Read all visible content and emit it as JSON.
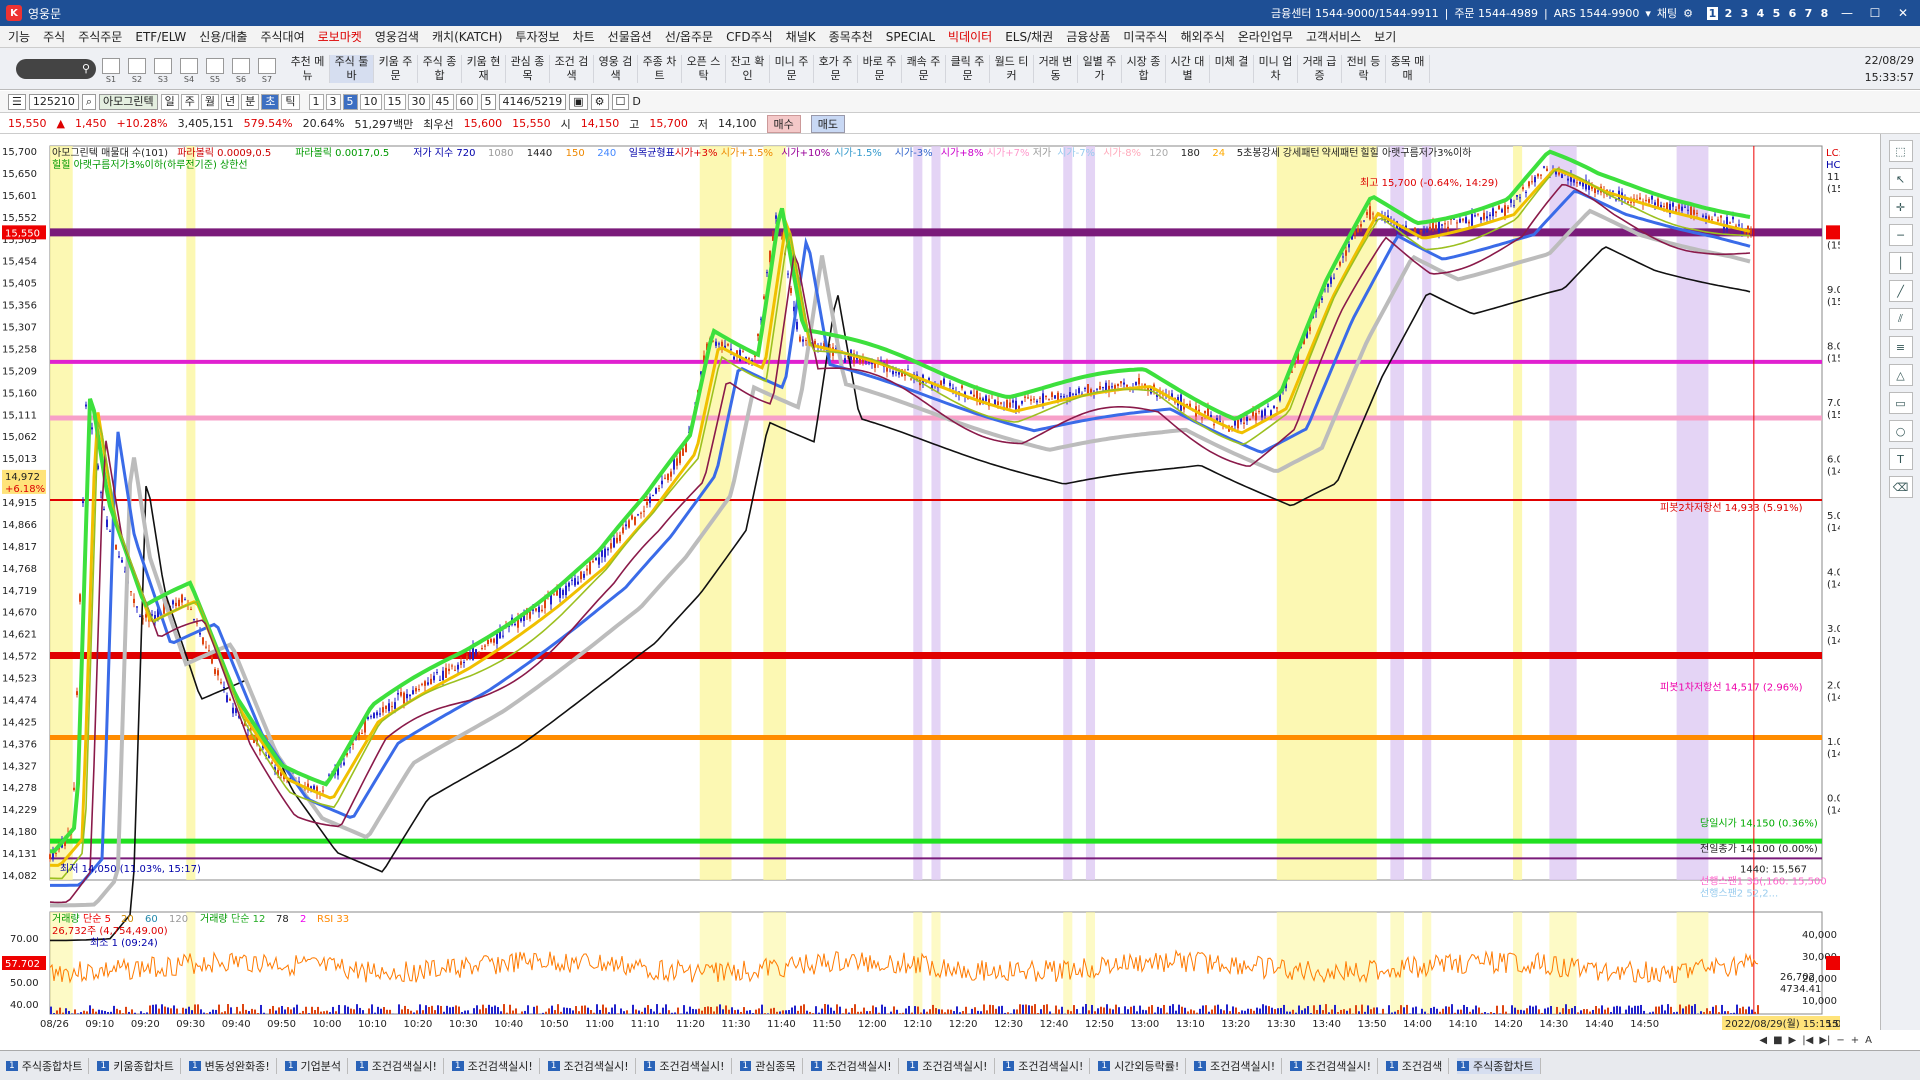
{
  "app": {
    "title": "영웅문",
    "company_center": "금융센터 1544-9000/1544-9911",
    "order_center": "주문 1544-4989",
    "ars": "ARS 1544-9900",
    "chat": "채팅",
    "pages": [
      "1",
      "2",
      "3",
      "4",
      "5",
      "6",
      "7",
      "8"
    ]
  },
  "menu": [
    "기능",
    "주식",
    "주식주문",
    "ETF/ELW",
    "신용/대출",
    "주식대여",
    "로보마켓",
    "영웅검색",
    "캐치(KATCH)",
    "투자정보",
    "차트",
    "선물옵션",
    "선/옵주문",
    "CFD주식",
    "채널K",
    "종목추천",
    "SPECIAL",
    "빅데이터",
    "ELS/채권",
    "금융상품",
    "미국주식",
    "해외주식",
    "온라인업무",
    "고객서비스",
    "보기"
  ],
  "toolbar": {
    "icon_labels": [
      "S1",
      "S2",
      "S3",
      "S4",
      "S5",
      "S6",
      "S7"
    ],
    "buttons": [
      "추천 메뉴",
      "주식 툴바",
      "키움 주문",
      "주식 종합",
      "키움 현재",
      "관심 종목",
      "조건 검색",
      "영웅 검색",
      "주종 차트",
      "오픈 스탁",
      "잔고 확인",
      "미니 주문",
      "호가 주문",
      "바로 주문",
      "쾌속 주문",
      "클릭 주문",
      "월드 티커",
      "거래 변동",
      "일별 주가",
      "시장 종합",
      "시간 대별",
      "미체 결",
      "미니 업차",
      "거래 급증",
      "전비 등락",
      "종목 매매"
    ],
    "date": "22/08/29",
    "time": "15:33:57"
  },
  "controls": {
    "code": "125210",
    "stock_name": "아모그린텍",
    "periods": [
      "일",
      "주",
      "월",
      "년",
      "분",
      "초",
      "틱"
    ],
    "intervals": [
      "1",
      "3",
      "5",
      "10",
      "15",
      "30",
      "45",
      "60"
    ],
    "selected_interval": "5",
    "count": "5",
    "range": "4146/5219",
    "d_label": "D"
  },
  "quote": {
    "price": "15,550",
    "change": "1,450",
    "change_rate": "+10.28%",
    "volume": "3,405,151",
    "vol_ratio": "579.54%",
    "turnover": "20.64%",
    "amount": "51,297백만",
    "best_ask_label": "최우선",
    "ask": "15,600",
    "bid": "15,550",
    "open_label": "시",
    "open": "14,150",
    "high_label": "고",
    "high": "15,700",
    "low_label": "저",
    "low": "14,100",
    "buy": "매수",
    "sell": "매도"
  },
  "legend": {
    "line1": [
      "아모그린텍 매물대 수(101)",
      "파라볼릭 0.0009,0.5",
      "파라볼릭 0.0017,0.5",
      "저가 지수 720",
      "1080",
      "1440",
      "150",
      "240",
      "일목균형표",
      "시가+3%",
      "시가+1.5%",
      "시가+10%",
      "시가-1.5%",
      "시가-3%",
      "시가+8%",
      "시가+7%",
      "저가",
      "시가-7%",
      "시가-8%",
      "120",
      "180",
      "24",
      "5초봉강세",
      "강세패턴",
      "약세패턴",
      "힐힐 아랫구름저가3%이하"
    ],
    "line2": "힐힐 아랫구름저가3%이하(하루전기준) 상한선"
  },
  "annotations": {
    "high": "최고 15,700 (-0.64%, 14:29)",
    "low": "최저 14,050 (11.03%, 15:17)",
    "pivot2": "피봇2차저항선 14,933 (5.91%)",
    "pivot1": "피봇1차저항선 14,517 (2.96%)",
    "open_line": "당일시가 14,150 (0.36%)",
    "prev": "전일종가 14,100 (0.00%)",
    "span1": "1440: 15,567",
    "span2": "선행스팬1 36(,160: 15,500",
    "span3": "선행스팬2 52,2...",
    "lc": "LC:10.68",
    "hc": "HC:-0.96",
    "cur_price": "15,550",
    "cur_rate": "10.28%",
    "cross_price": "14,972",
    "cross_rate": "+6.18%"
  },
  "price_axis": [
    "15,700",
    "15,650",
    "15,601",
    "15,552",
    "15,503",
    "15,454",
    "15,405",
    "15,356",
    "15,307",
    "15,258",
    "15,209",
    "15,160",
    "15,111",
    "15,062",
    "15,013",
    "14,964",
    "14,915",
    "14,866",
    "14,817",
    "14,768",
    "14,719",
    "14,670",
    "14,621",
    "14,572",
    "14,523",
    "14,474",
    "14,425",
    "14,376",
    "14,327",
    "14,278",
    "14,229",
    "14,180",
    "14,131",
    "14,082"
  ],
  "pct_axis": [
    {
      "p": "11.0%",
      "v": "(15,651)"
    },
    {
      "p": "10.0%",
      "v": "(15,510)"
    },
    {
      "p": "9.0%",
      "v": "(15,369)"
    },
    {
      "p": "8.0%",
      "v": "(15,228)"
    },
    {
      "p": "7.0%",
      "v": "(15,087)"
    },
    {
      "p": "6.0%",
      "v": "(14,946)"
    },
    {
      "p": "5.0%",
      "v": "(14,805)"
    },
    {
      "p": "4.0%",
      "v": "(14,664)"
    },
    {
      "p": "3.0%",
      "v": "(14,523)"
    },
    {
      "p": "2.0%",
      "v": "(14,382)"
    },
    {
      "p": "1.0%",
      "v": "(14,241)"
    },
    {
      "p": "0.0%",
      "v": "(14,100)"
    }
  ],
  "sub_legend": [
    "거래량",
    "단순 5",
    "20",
    "60",
    "120",
    "거래량",
    "단순 12",
    "78",
    "2",
    "RSI 33"
  ],
  "sub_notes": [
    "26,732주 (4,754,49.00)",
    "최소 1 (09:24)"
  ],
  "sub_left_axis": [
    "70.00",
    "60.00",
    "50.00",
    "40.00"
  ],
  "sub_right_axis": [
    "40,000",
    "30,000",
    "20,000",
    "10,000"
  ],
  "sub_cur": {
    "rsi": "57.702",
    "vol": "26,702",
    "vol2": "4734.41"
  },
  "time_axis": [
    "08/26",
    "09:10",
    "09:20",
    "09:30",
    "09:40",
    "09:50",
    "10:00",
    "10:10",
    "10:20",
    "10:30",
    "10:40",
    "10:50",
    "11:00",
    "11:10",
    "11:20",
    "11:30",
    "11:40",
    "11:50",
    "12:00",
    "12:10",
    "12:20",
    "12:30",
    "12:40",
    "12:50",
    "13:00",
    "13:10",
    "13:20",
    "13:30",
    "13:40",
    "13:50",
    "14:00",
    "14:10",
    "14:20",
    "14:30",
    "14:40",
    "14:50"
  ],
  "time_cursor": "2022/08/29(월) 15:15:05",
  "time_end": "15:30:00",
  "chart_data": {
    "type": "line",
    "title": "",
    "x_range": [
      "09:00",
      "15:30"
    ],
    "ylim": [
      14050,
      15750
    ],
    "price_path": [
      {
        "t": "09:00",
        "v": 14100
      },
      {
        "t": "09:05",
        "v": 14160
      },
      {
        "t": "09:08",
        "v": 15170
      },
      {
        "t": "09:12",
        "v": 14900
      },
      {
        "t": "09:20",
        "v": 14650
      },
      {
        "t": "09:30",
        "v": 14700
      },
      {
        "t": "09:40",
        "v": 14450
      },
      {
        "t": "09:50",
        "v": 14300
      },
      {
        "t": "10:00",
        "v": 14250
      },
      {
        "t": "10:10",
        "v": 14420
      },
      {
        "t": "10:30",
        "v": 14550
      },
      {
        "t": "10:50",
        "v": 14700
      },
      {
        "t": "11:00",
        "v": 14780
      },
      {
        "t": "11:10",
        "v": 14900
      },
      {
        "t": "11:20",
        "v": 15050
      },
      {
        "t": "11:25",
        "v": 15300
      },
      {
        "t": "11:35",
        "v": 15250
      },
      {
        "t": "11:40",
        "v": 15600
      },
      {
        "t": "11:45",
        "v": 15300
      },
      {
        "t": "12:00",
        "v": 15250
      },
      {
        "t": "12:30",
        "v": 15150
      },
      {
        "t": "13:00",
        "v": 15200
      },
      {
        "t": "13:20",
        "v": 15100
      },
      {
        "t": "13:30",
        "v": 15150
      },
      {
        "t": "13:40",
        "v": 15400
      },
      {
        "t": "13:50",
        "v": 15600
      },
      {
        "t": "14:00",
        "v": 15550
      },
      {
        "t": "14:20",
        "v": 15600
      },
      {
        "t": "14:29",
        "v": 15700
      },
      {
        "t": "14:40",
        "v": 15650
      },
      {
        "t": "15:00",
        "v": 15600
      },
      {
        "t": "15:15",
        "v": 15550
      }
    ],
    "levels": [
      {
        "name": "피봇2차저항선",
        "v": 14933
      },
      {
        "name": "피봇1차저항선",
        "v": 14517
      },
      {
        "name": "당일시가",
        "v": 14150
      },
      {
        "name": "전일종가",
        "v": 14100
      }
    ],
    "colors": {
      "price_up": "#d41",
      "price_down": "#22c",
      "ma_green": "#3de03d",
      "ma_blue": "#3a6be8",
      "ma_gray": "#bcbcbc",
      "ma_black": "#111",
      "purple_band": "#7a1b7a",
      "magenta_band": "#e020d0",
      "pink_band": "#f7a0c8",
      "red_band": "#e00000",
      "orange_band": "#ff8c00",
      "green_band": "#20e020",
      "rsi": "#ff7a00"
    }
  },
  "sidebar_icons": [
    "cursor-icon",
    "crosshair-icon",
    "hline-icon",
    "vline-icon",
    "trend-icon",
    "channel-icon",
    "fib-icon",
    "triangle-icon",
    "rect-icon",
    "circle-icon",
    "text-icon",
    "eraser-icon",
    "magnet-icon"
  ],
  "bottomnav": [
    "◀",
    "■",
    "▶",
    "|◀",
    "▶|",
    "−",
    "+",
    "A"
  ],
  "taskbar": [
    "주식종합차트",
    "키움종합차트",
    "변동성완화종!",
    "기업분석",
    "조건검색실시!",
    "조건검색실시!",
    "조건검색실시!",
    "조건검색실시!",
    "관심종목",
    "조건검색실시!",
    "조건검색실시!",
    "조건검색실시!",
    "시간외등락률!",
    "조건검색실시!",
    "조건검색실시!",
    "조건검색",
    "주식종합차트"
  ],
  "task_num": "1"
}
